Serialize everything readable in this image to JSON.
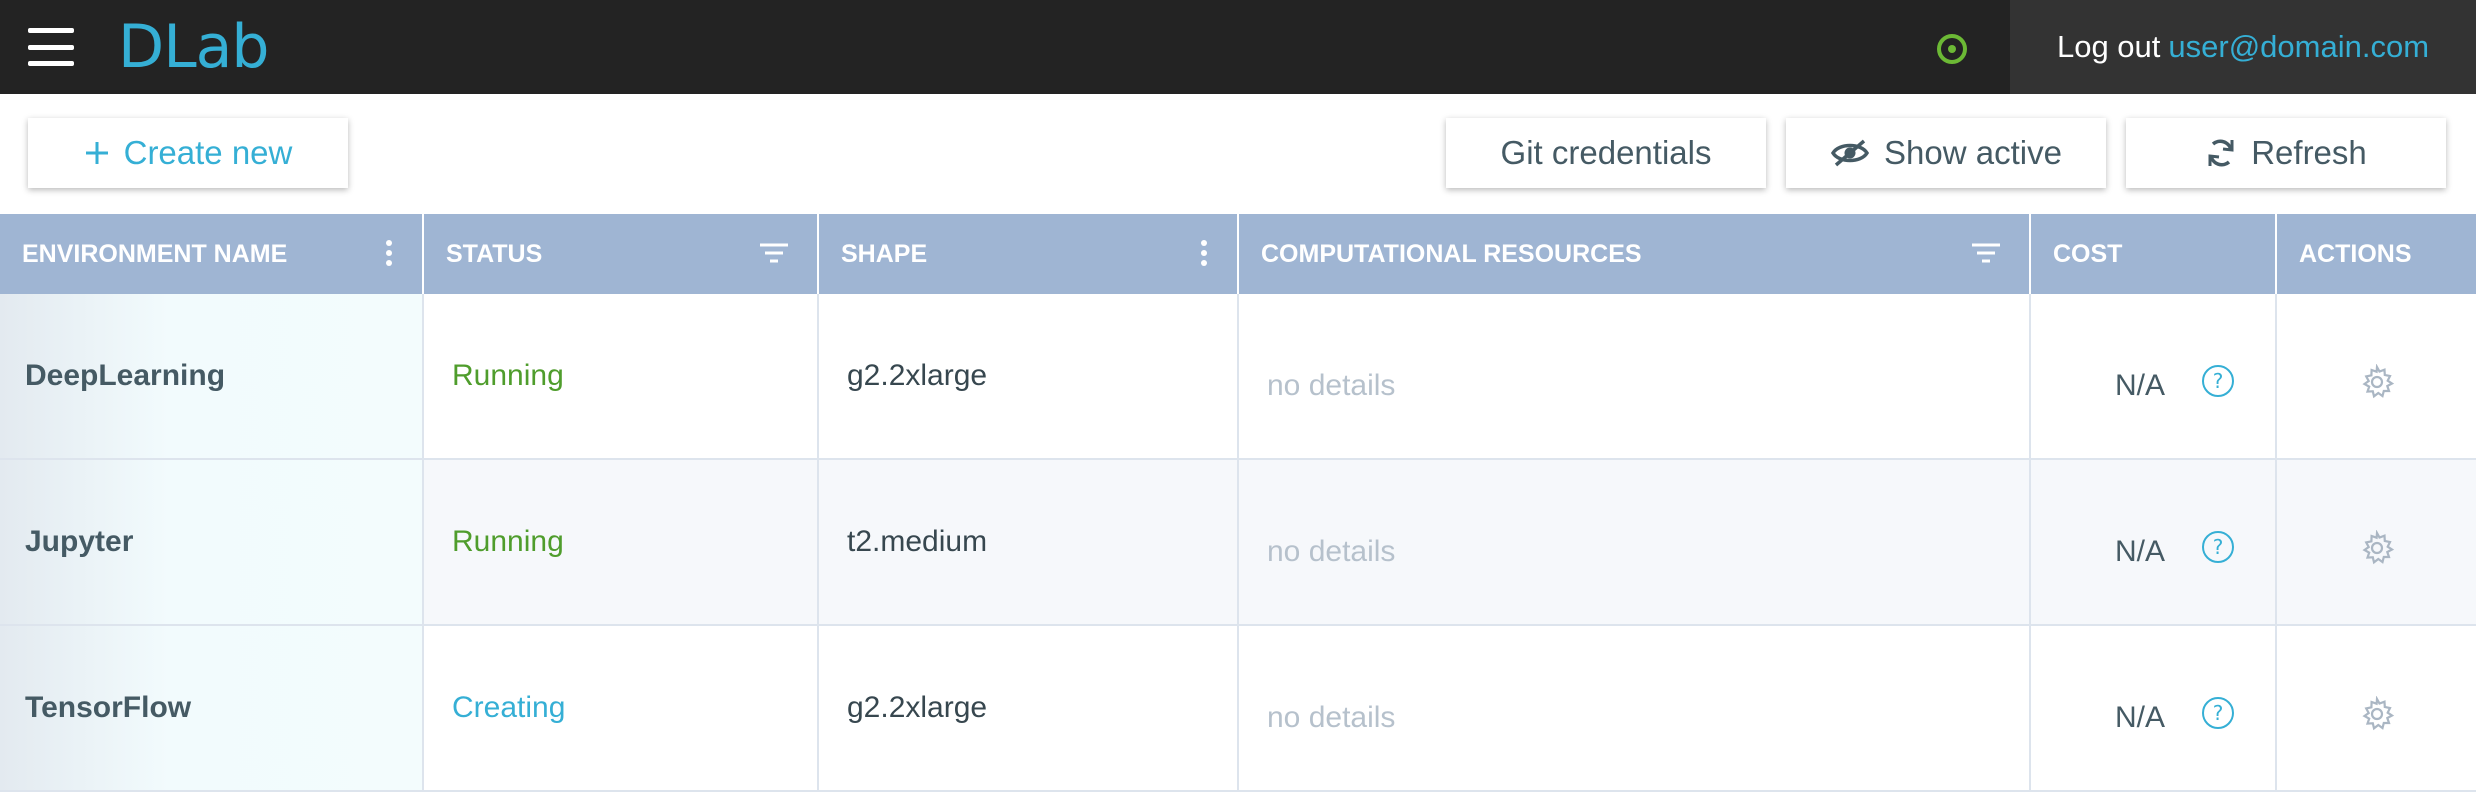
{
  "header": {
    "logo": "DLab",
    "logout_label": "Log out",
    "user_email": "user@domain.com"
  },
  "toolbar": {
    "create_label": "Create new",
    "git_label": "Git credentials",
    "show_active_label": "Show active",
    "refresh_label": "Refresh"
  },
  "table": {
    "columns": {
      "name": "ENVIRONMENT NAME",
      "status": "STATUS",
      "shape": "SHAPE",
      "resources": "COMPUTATIONAL RESOURCES",
      "cost": "COST",
      "actions": "ACTIONS"
    },
    "rows": [
      {
        "name": "DeepLearning",
        "status": "Running",
        "shape": "g2.2xlarge",
        "resources": "no details",
        "cost": "N/A"
      },
      {
        "name": "Jupyter",
        "status": "Running",
        "shape": "t2.medium",
        "resources": "no details",
        "cost": "N/A"
      },
      {
        "name": "TensorFlow",
        "status": "Creating",
        "shape": "g2.2xlarge",
        "resources": "no details",
        "cost": "N/A"
      }
    ]
  },
  "colors": {
    "topbar": "#232323",
    "accent": "#35afd5",
    "header_row": "#9fb5d3",
    "running": "#4f9d2c",
    "creating": "#35afd5",
    "status_indicator": "#6cb935"
  },
  "icons": {
    "menu": "hamburger-menu-icon",
    "status": "status-indicator-icon",
    "create": "plus-icon",
    "show_active": "eye-off-icon",
    "refresh": "refresh-icon",
    "column_menu": "vertical-dots-icon",
    "filter": "filter-icon",
    "help": "question-circle-icon",
    "actions": "gear-icon"
  }
}
